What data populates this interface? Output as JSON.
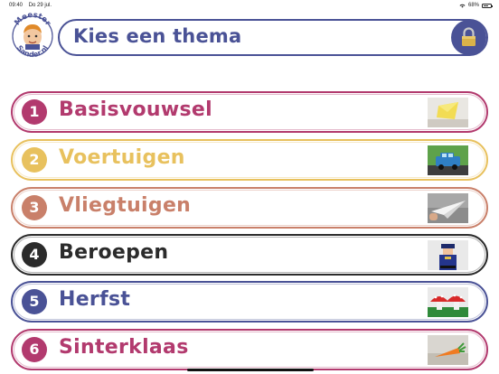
{
  "status_bar": {
    "time": "09:40",
    "date": "Do 29 jul.",
    "battery": "68%",
    "battery_level": 0.68
  },
  "header": {
    "title": "Kies een thema",
    "logo_text_top": "Meester",
    "logo_text_bottom": "Sander.nl"
  },
  "colors": {
    "header": "#4a5296",
    "basisvouwsel": "#b23a6e",
    "voertuigen": "#e8c15e",
    "vliegtuigen": "#c9806a",
    "beroepen": "#2b2b2b",
    "herfst": "#4a5296",
    "sinterklaas": "#b23a6e"
  },
  "themes": [
    {
      "number": "1",
      "label": "Basisvouwsel",
      "color": "#b23a6e",
      "icon": "paper-fold-thumbnail"
    },
    {
      "number": "2",
      "label": "Voertuigen",
      "color": "#e8c15e",
      "icon": "car-thumbnail"
    },
    {
      "number": "3",
      "label": "Vliegtuigen",
      "color": "#c9806a",
      "icon": "paper-plane-thumbnail"
    },
    {
      "number": "4",
      "label": "Beroepen",
      "color": "#2b2b2b",
      "icon": "police-officer-thumbnail"
    },
    {
      "number": "5",
      "label": "Herfst",
      "color": "#4a5296",
      "icon": "mushroom-thumbnail"
    },
    {
      "number": "6",
      "label": "Sinterklaas",
      "color": "#b23a6e",
      "icon": "carrot-thumbnail"
    }
  ]
}
